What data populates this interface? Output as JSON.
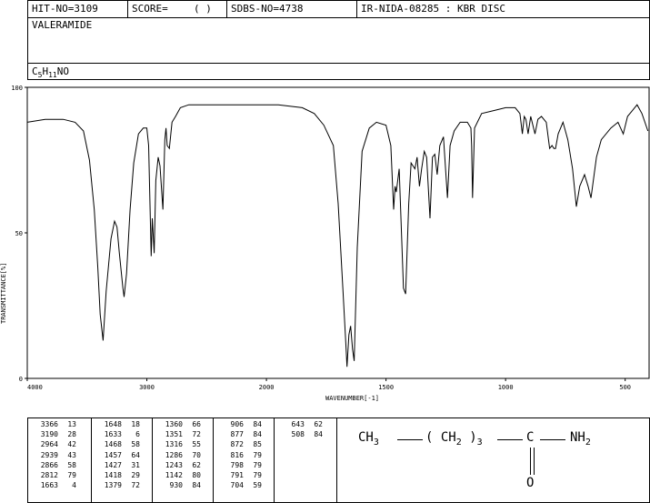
{
  "header": {
    "hit_no": "HIT-NO=3109",
    "score_label": "SCORE=",
    "score_value": "( )",
    "sdbs_no": "SDBS-NO=4738",
    "ir_code": "IR-NIDA-08285 : KBR DISC",
    "compound_name": "VALERAMIDE",
    "formula_parts": {
      "c": "C",
      "c_sub": "5",
      "h": "H",
      "h_sub": "11",
      "rest": "NO"
    }
  },
  "chart_data": {
    "type": "line",
    "xlabel": "WAVENUMBER[-1]",
    "ylabel": "TRANSMITTANCE[%]",
    "xlim": [
      4000,
      400
    ],
    "ylim": [
      0,
      100
    ],
    "x_ticks": [
      4000,
      3000,
      2000,
      1500,
      1000,
      500
    ],
    "y_ticks": [
      0,
      50,
      100
    ],
    "series": [
      {
        "points": [
          [
            4000,
            88
          ],
          [
            3850,
            89
          ],
          [
            3700,
            89
          ],
          [
            3600,
            88
          ],
          [
            3530,
            85
          ],
          [
            3480,
            75
          ],
          [
            3440,
            58
          ],
          [
            3410,
            38
          ],
          [
            3390,
            22
          ],
          [
            3366,
            13
          ],
          [
            3340,
            30
          ],
          [
            3300,
            48
          ],
          [
            3270,
            54
          ],
          [
            3250,
            52
          ],
          [
            3230,
            43
          ],
          [
            3200,
            31
          ],
          [
            3190,
            28
          ],
          [
            3170,
            36
          ],
          [
            3140,
            58
          ],
          [
            3110,
            74
          ],
          [
            3070,
            84
          ],
          [
            3030,
            86
          ],
          [
            3000,
            86
          ],
          [
            2985,
            80
          ],
          [
            2964,
            42
          ],
          [
            2955,
            55
          ],
          [
            2939,
            43
          ],
          [
            2925,
            68
          ],
          [
            2905,
            76
          ],
          [
            2890,
            73
          ],
          [
            2866,
            58
          ],
          [
            2850,
            82
          ],
          [
            2840,
            86
          ],
          [
            2830,
            80
          ],
          [
            2812,
            79
          ],
          [
            2790,
            88
          ],
          [
            2760,
            90
          ],
          [
            2720,
            93
          ],
          [
            2650,
            94
          ],
          [
            2500,
            94
          ],
          [
            2300,
            94
          ],
          [
            2100,
            94
          ],
          [
            1950,
            94
          ],
          [
            1850,
            93
          ],
          [
            1800,
            91
          ],
          [
            1760,
            87
          ],
          [
            1720,
            80
          ],
          [
            1700,
            60
          ],
          [
            1680,
            30
          ],
          [
            1668,
            12
          ],
          [
            1663,
            4
          ],
          [
            1655,
            15
          ],
          [
            1648,
            18
          ],
          [
            1640,
            10
          ],
          [
            1633,
            6
          ],
          [
            1620,
            45
          ],
          [
            1600,
            78
          ],
          [
            1570,
            86
          ],
          [
            1540,
            88
          ],
          [
            1500,
            87
          ],
          [
            1480,
            80
          ],
          [
            1468,
            58
          ],
          [
            1462,
            66
          ],
          [
            1457,
            64
          ],
          [
            1445,
            72
          ],
          [
            1427,
            31
          ],
          [
            1418,
            29
          ],
          [
            1405,
            60
          ],
          [
            1395,
            74
          ],
          [
            1379,
            72
          ],
          [
            1370,
            76
          ],
          [
            1360,
            66
          ],
          [
            1351,
            72
          ],
          [
            1340,
            78
          ],
          [
            1330,
            76
          ],
          [
            1316,
            55
          ],
          [
            1306,
            76
          ],
          [
            1296,
            77
          ],
          [
            1286,
            70
          ],
          [
            1275,
            80
          ],
          [
            1260,
            83
          ],
          [
            1243,
            62
          ],
          [
            1232,
            80
          ],
          [
            1215,
            85
          ],
          [
            1190,
            88
          ],
          [
            1160,
            88
          ],
          [
            1145,
            86
          ],
          [
            1142,
            80
          ],
          [
            1138,
            62
          ],
          [
            1130,
            86
          ],
          [
            1100,
            91
          ],
          [
            1050,
            92
          ],
          [
            1000,
            93
          ],
          [
            960,
            93
          ],
          [
            940,
            91
          ],
          [
            930,
            84
          ],
          [
            922,
            90
          ],
          [
            915,
            89
          ],
          [
            906,
            84
          ],
          [
            895,
            90
          ],
          [
            877,
            84
          ],
          [
            865,
            89
          ],
          [
            850,
            90
          ],
          [
            830,
            88
          ],
          [
            816,
            79
          ],
          [
            806,
            80
          ],
          [
            798,
            79
          ],
          [
            791,
            79
          ],
          [
            780,
            84
          ],
          [
            760,
            88
          ],
          [
            740,
            82
          ],
          [
            720,
            72
          ],
          [
            704,
            59
          ],
          [
            690,
            66
          ],
          [
            670,
            70
          ],
          [
            655,
            66
          ],
          [
            643,
            62
          ],
          [
            620,
            76
          ],
          [
            600,
            82
          ],
          [
            560,
            86
          ],
          [
            530,
            88
          ],
          [
            508,
            84
          ],
          [
            490,
            90
          ],
          [
            470,
            92
          ],
          [
            450,
            94
          ],
          [
            430,
            91
          ],
          [
            405,
            85
          ]
        ]
      }
    ],
    "peak_table": [
      [
        [
          3366,
          13
        ],
        [
          3190,
          28
        ],
        [
          2964,
          42
        ],
        [
          2939,
          43
        ],
        [
          2866,
          58
        ],
        [
          2812,
          79
        ],
        [
          1663,
          4
        ]
      ],
      [
        [
          1648,
          18
        ],
        [
          1633,
          6
        ],
        [
          1468,
          58
        ],
        [
          1457,
          64
        ],
        [
          1427,
          31
        ],
        [
          1418,
          29
        ],
        [
          1379,
          72
        ]
      ],
      [
        [
          1360,
          66
        ],
        [
          1351,
          72
        ],
        [
          1316,
          55
        ],
        [
          1286,
          70
        ],
        [
          1243,
          62
        ],
        [
          1142,
          80
        ],
        [
          930,
          84
        ]
      ],
      [
        [
          906,
          84
        ],
        [
          877,
          84
        ],
        [
          872,
          85
        ],
        [
          816,
          79
        ],
        [
          798,
          79
        ],
        [
          791,
          79
        ],
        [
          704,
          59
        ]
      ],
      [
        [
          643,
          62
        ],
        [
          508,
          84
        ]
      ]
    ]
  },
  "structure": {
    "ch3": "CH",
    "ch3_sub": "3",
    "chain_open": "(",
    "chain_ch2": "CH",
    "chain_ch2_sub": "2",
    "chain_close": ")",
    "chain_repeat": "3",
    "carbon": "C",
    "nh2": "NH",
    "nh2_sub": "2",
    "oxygen": "O"
  }
}
